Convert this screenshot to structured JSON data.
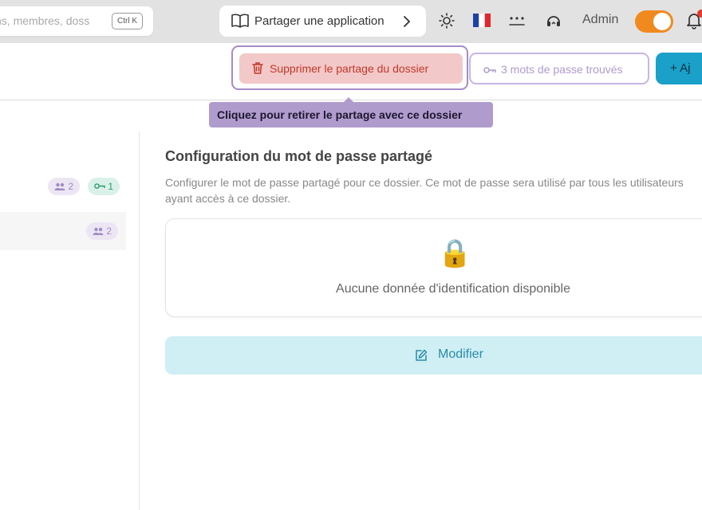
{
  "topbar": {
    "search_placeholder": "ns, membres, doss",
    "search_shortcut": "Ctrl K",
    "share_app_label": "Partager une application",
    "user_label": "Admin"
  },
  "actions": {
    "delete_share_label": "Supprimer le partage du dossier",
    "passwords_found_label": "3 mots de passe trouvés",
    "add_label": "+ Aj"
  },
  "tooltip": {
    "text": "Cliquez pour retirer le partage avec ce dossier"
  },
  "sidebar": {
    "rows": [
      {
        "members": "2",
        "keys": "1"
      },
      {
        "members": "2"
      }
    ]
  },
  "main": {
    "title": "Configuration du mot de passe partagé",
    "description": "Configurer le mot de passe partagé pour ce dossier. Ce mot de passe sera utilisé par tous les utilisateurs ayant accès à ce dossier.",
    "empty_icon": "🔒",
    "empty_text": "Aucune donnée d'identification disponible",
    "modify_label": "Modifier"
  },
  "colors": {
    "accent_orange": "#f08a1e",
    "danger": "#c0392b",
    "primary": "#1ba0c9",
    "tooltip": "#b09ccc"
  }
}
